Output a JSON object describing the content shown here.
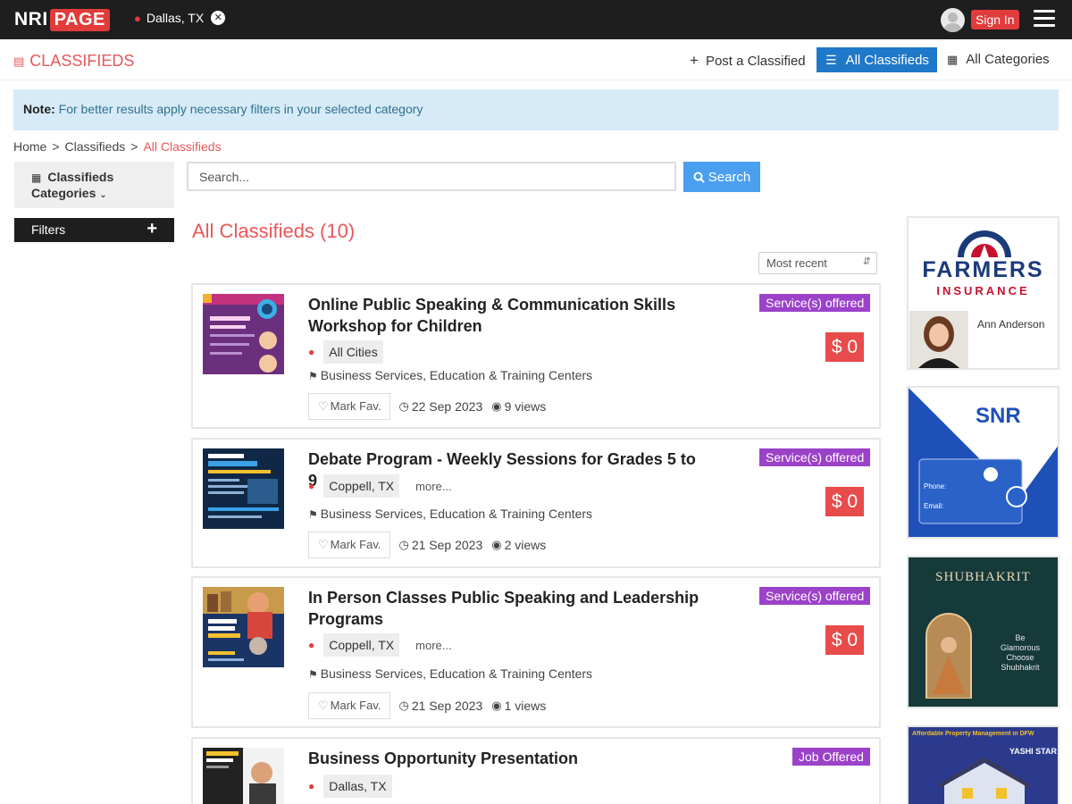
{
  "header": {
    "logo_nri": "NRI",
    "logo_page": "PAGE",
    "location": "Dallas, TX",
    "signin_label": "Sign In"
  },
  "subheader": {
    "section_title": "CLASSIFIEDS",
    "post_label": "Post a Classified",
    "all_label": "All Classifieds",
    "categories_label": "All Categories"
  },
  "note": {
    "label": "Note:",
    "text": "For better results apply necessary filters in your selected category"
  },
  "breadcrumb": [
    "Home",
    ">",
    "Classifieds",
    ">",
    "All Classifieds"
  ],
  "sidebar": {
    "categories_line1": "Classifieds",
    "categories_line2": "Categories",
    "filters_label": "Filters"
  },
  "search": {
    "placeholder": "Search...",
    "button_label": "Search"
  },
  "listing": {
    "heading": "All Classifieds (10)",
    "sort_value": "Most recent",
    "fav_label": "Mark Fav.",
    "items": [
      {
        "title_line1": "Online Public Speaking & Communication Skills",
        "title_line2": "Workshop for Children",
        "badge": "Service(s) offered",
        "price": "$ 0",
        "city": "All Cities",
        "more": "",
        "categories": "Business Services, Education & Training Centers",
        "date": "22 Sep 2023",
        "views": "9 views"
      },
      {
        "title_line1": "Debate Program - Weekly Sessions for Grades 5 to 9",
        "title_line2": "",
        "badge": "Service(s) offered",
        "price": "$ 0",
        "city": "Coppell, TX",
        "more": "more...",
        "categories": "Business Services, Education & Training Centers",
        "date": "21 Sep 2023",
        "views": "2 views"
      },
      {
        "title_line1": "In Person Classes Public Speaking and Leadership",
        "title_line2": "Programs",
        "badge": "Service(s) offered",
        "price": "$ 0",
        "city": "Coppell, TX",
        "more": "more...",
        "categories": "Business Services, Education & Training Centers",
        "date": "21 Sep 2023",
        "views": "1 views"
      },
      {
        "title_line1": "Business Opportunity Presentation",
        "title_line2": "",
        "badge": "Job Offered",
        "city": "Dallas, TX"
      }
    ]
  },
  "ads": {
    "farmers_line1": "FARMERS",
    "farmers_line2": "INSURANCE",
    "farmers_agent": "Ann Anderson",
    "snr_title": "SNR",
    "snr_phone_label": "Phone:",
    "snr_email_label": "Email:",
    "shubhakrit_title": "SHUBHAKRIT",
    "shubhakrit_text_1": "Be",
    "shubhakrit_text_2": "Glamorous",
    "shubhakrit_text_3": "Choose",
    "shubhakrit_text_4": "Shubhakrit",
    "property_title": "Affordable Property Management in DFW",
    "property_brand": "YASHI STAR"
  },
  "colors": {
    "accent_red": "#e8575a",
    "primary_blue": "#1f78c8",
    "badge_purple": "#9b42c9",
    "price_red": "#e84b4b",
    "note_bg": "#d6ebf7"
  }
}
